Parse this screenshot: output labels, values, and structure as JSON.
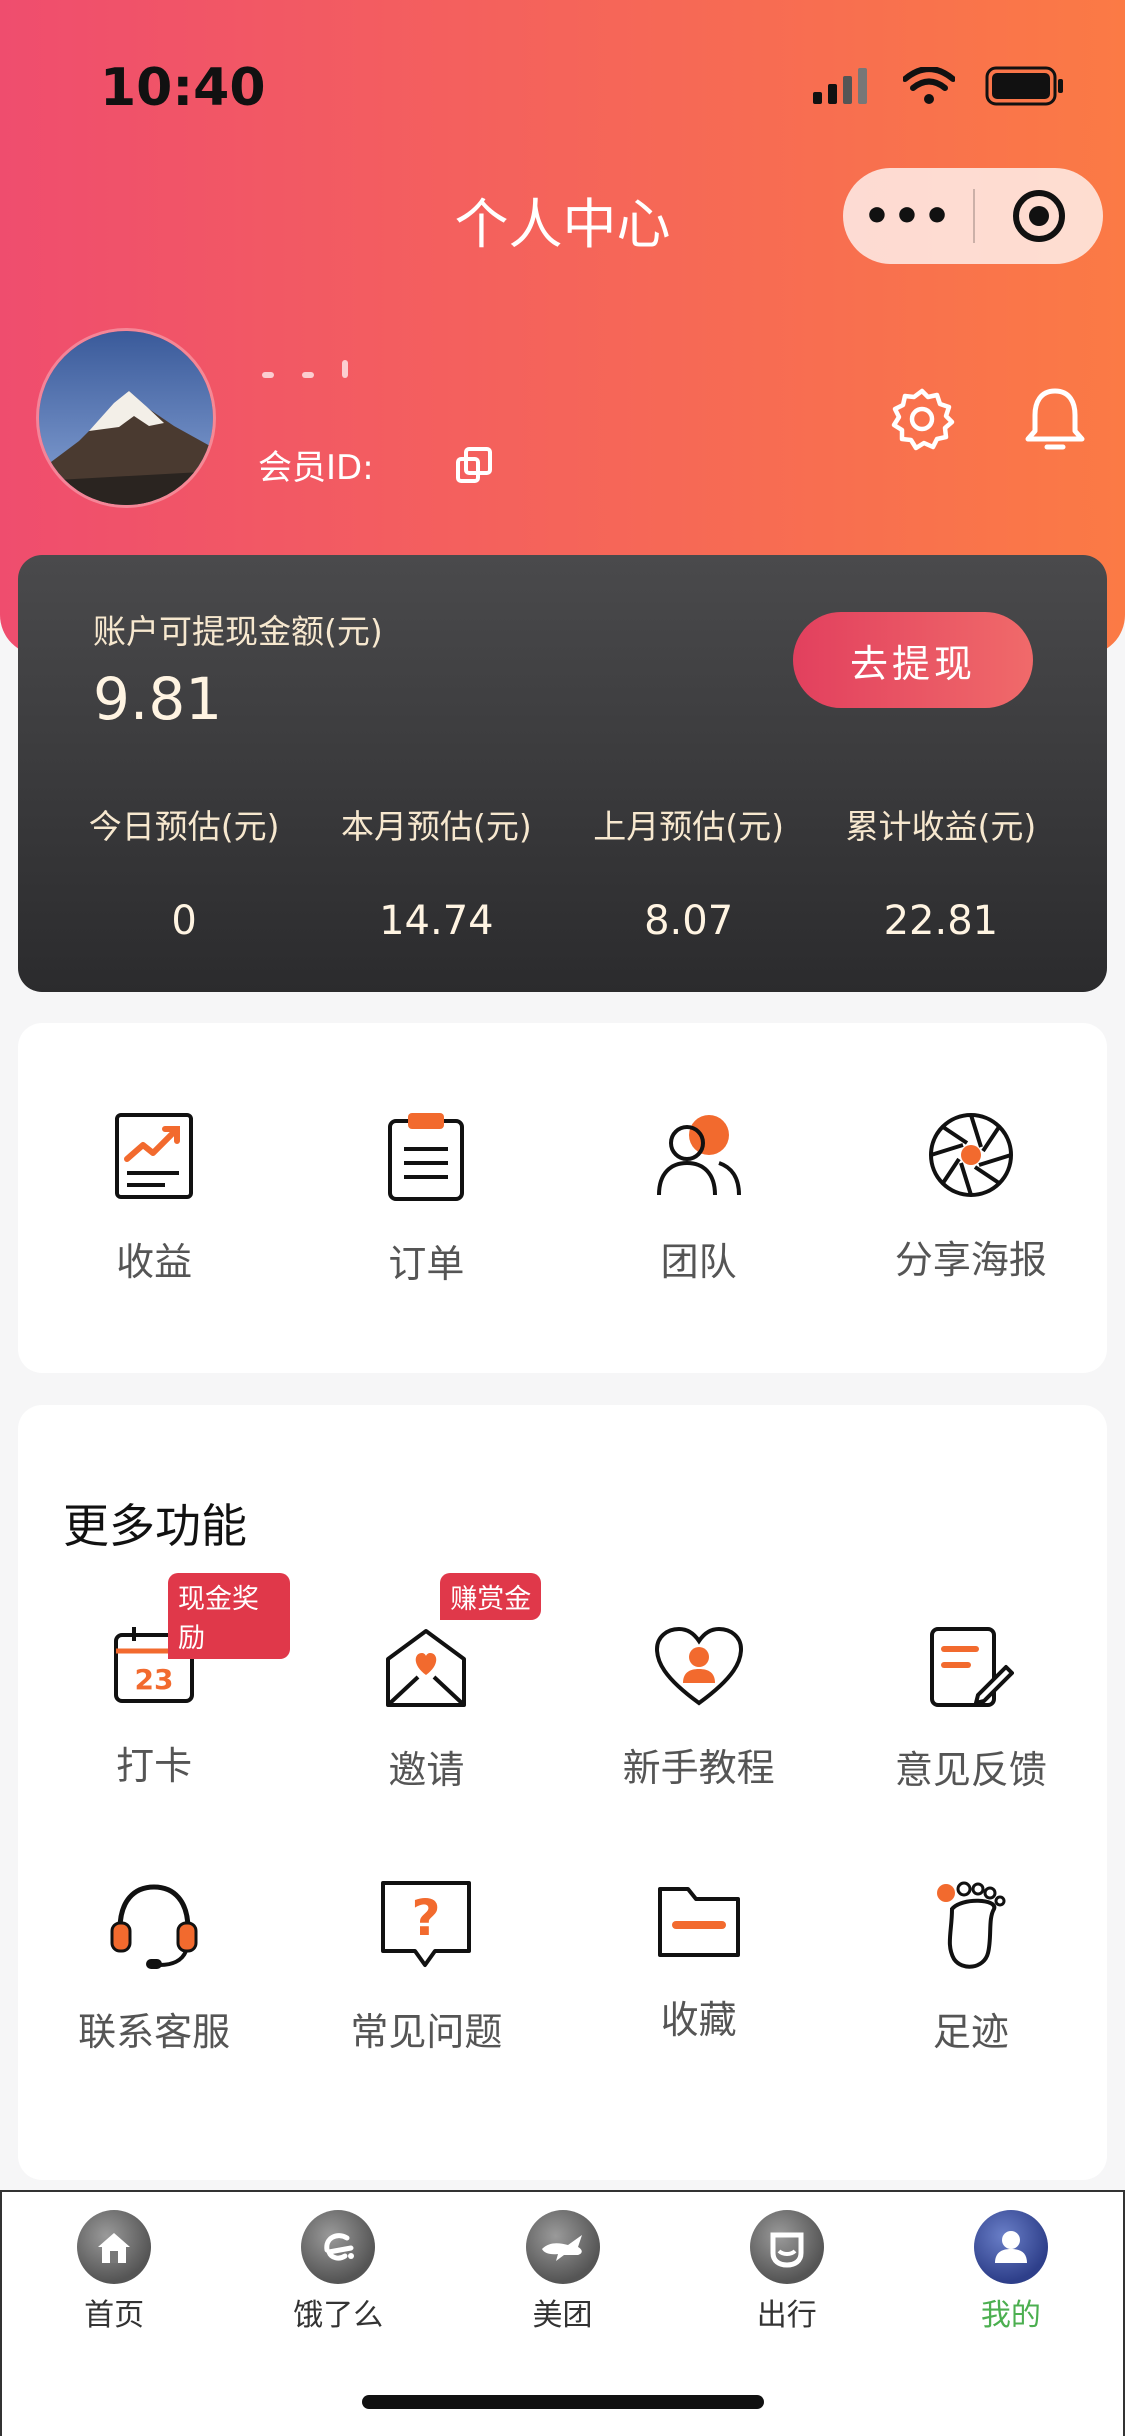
{
  "status_bar": {
    "time": "10:40"
  },
  "header": {
    "title": "个人中心",
    "capsule_menu": "•••",
    "member_id_label": "会员ID:"
  },
  "wallet": {
    "withdrawable_label": "账户可提现金额(元)",
    "withdrawable_amount": "9.81",
    "withdraw_button": "去提现",
    "stats": [
      {
        "label": "今日预估(元)",
        "value": "0"
      },
      {
        "label": "本月预估(元)",
        "value": "14.74"
      },
      {
        "label": "上月预估(元)",
        "value": "8.07"
      },
      {
        "label": "累计收益(元)",
        "value": "22.81"
      }
    ]
  },
  "quick_actions": [
    {
      "label": "收益",
      "icon": "earnings-chart-icon"
    },
    {
      "label": "订单",
      "icon": "clipboard-icon"
    },
    {
      "label": "团队",
      "icon": "team-icon"
    },
    {
      "label": "分享海报",
      "icon": "aperture-icon"
    }
  ],
  "more_features": {
    "title": "更多功能",
    "items": [
      {
        "label": "打卡",
        "icon": "calendar-icon",
        "badge": "现金奖励",
        "calendar_day": "23"
      },
      {
        "label": "邀请",
        "icon": "invite-envelope-icon",
        "badge": "赚赏金"
      },
      {
        "label": "新手教程",
        "icon": "heart-user-icon"
      },
      {
        "label": "意见反馈",
        "icon": "feedback-edit-icon"
      },
      {
        "label": "联系客服",
        "icon": "headset-icon"
      },
      {
        "label": "常见问题",
        "icon": "question-bubble-icon",
        "glyph": "?"
      },
      {
        "label": "收藏",
        "icon": "folder-icon"
      },
      {
        "label": "足迹",
        "icon": "footprint-icon"
      }
    ]
  },
  "tabbar": [
    {
      "label": "首页",
      "icon": "home-icon"
    },
    {
      "label": "饿了么",
      "icon": "eleme-icon"
    },
    {
      "label": "美团",
      "icon": "meituan-icon"
    },
    {
      "label": "出行",
      "icon": "didi-icon"
    },
    {
      "label": "我的",
      "icon": "profile-icon",
      "active": true
    }
  ],
  "colors": {
    "header_gradient_start": "#ef4d6e",
    "header_gradient_end": "#fb7a45",
    "accent_orange": "#f26a2e",
    "active_tab": "#4caf50",
    "badge": "#e0384a"
  }
}
